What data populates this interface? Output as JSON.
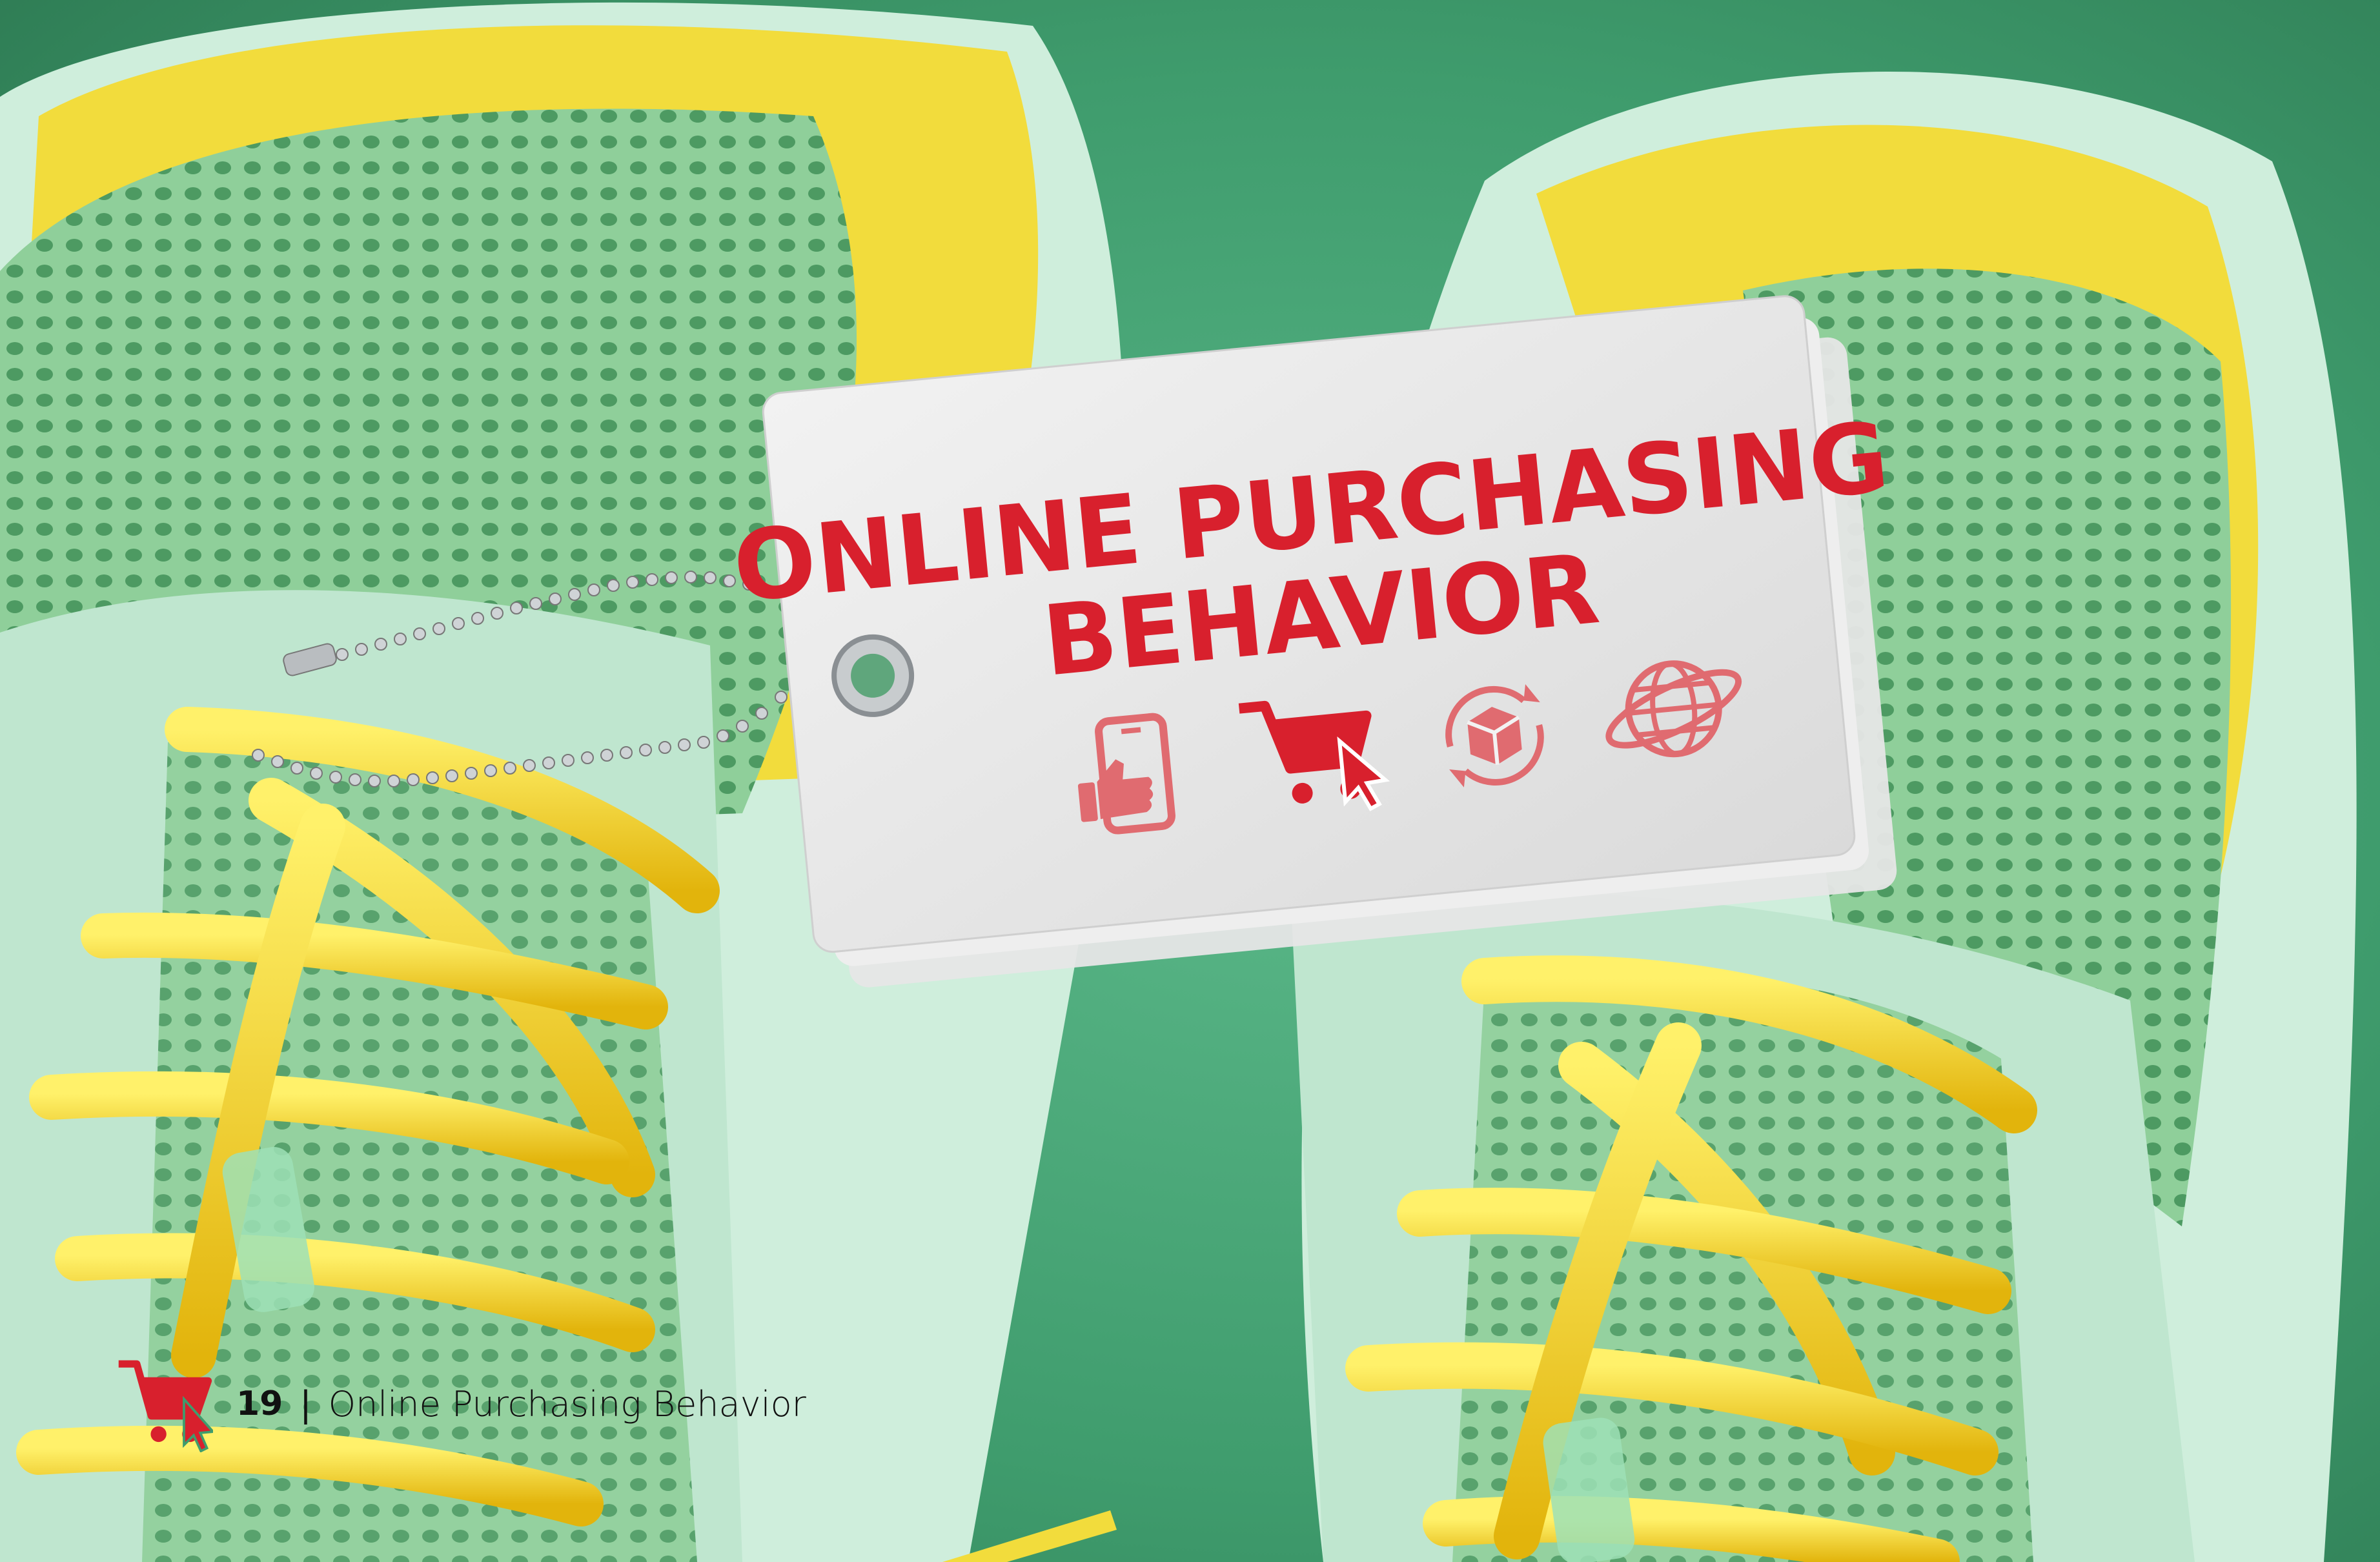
{
  "tag": {
    "title_line1": "ONLINE PURCHASING",
    "title_line2": "BEHAVIOR",
    "icons": [
      "phone-thumbs-up-icon",
      "shopping-cart-cursor-icon",
      "box-return-cycle-icon",
      "globe-orbit-icon"
    ]
  },
  "footer": {
    "page_number": "19",
    "separator": "|",
    "running_title": "Online Purchasing Behavior"
  },
  "colors": {
    "accent_red": "#d8202d",
    "accent_yellow": "#f5cc1a",
    "background_green": "#3f9c6d",
    "mint": "#bfe6cf"
  }
}
